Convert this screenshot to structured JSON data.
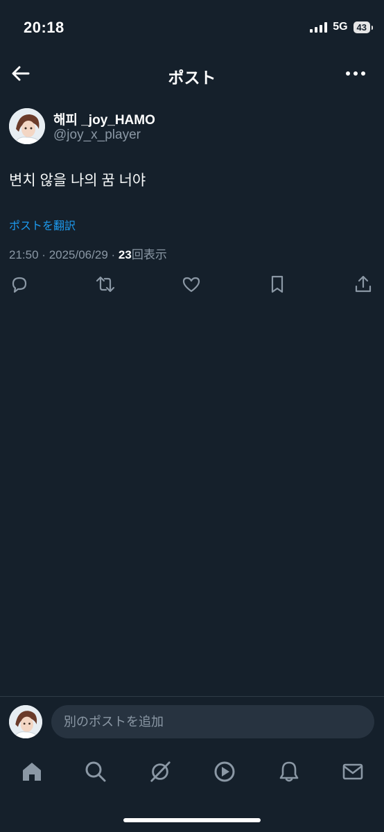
{
  "status_bar": {
    "time": "20:18",
    "network": "5G",
    "battery": "43"
  },
  "header": {
    "title": "ポスト",
    "back_icon": "arrow-left-icon",
    "more_icon": "more-horizontal-icon"
  },
  "post": {
    "display_name": "해피 _joy_HAMO",
    "handle": "@joy_x_player",
    "text": "변치 않을 나의 꿈 너야",
    "translate_label": "ポストを翻訳",
    "time": "21:50",
    "date": "2025/06/29",
    "separator": "·",
    "view_count": "23",
    "view_label": "回表示",
    "actions": [
      "reply-icon",
      "repost-icon",
      "like-icon",
      "bookmark-icon",
      "share-icon"
    ]
  },
  "reply_box": {
    "placeholder": "別のポストを追加"
  },
  "tab_bar": {
    "items": [
      "home-icon",
      "search-icon",
      "grok-icon",
      "video-icon",
      "notifications-icon",
      "messages-icon"
    ]
  },
  "colors": {
    "background": "#15202b",
    "accent": "#1d9bf0",
    "secondary_text": "#8b98a5",
    "input_background": "#273340"
  }
}
